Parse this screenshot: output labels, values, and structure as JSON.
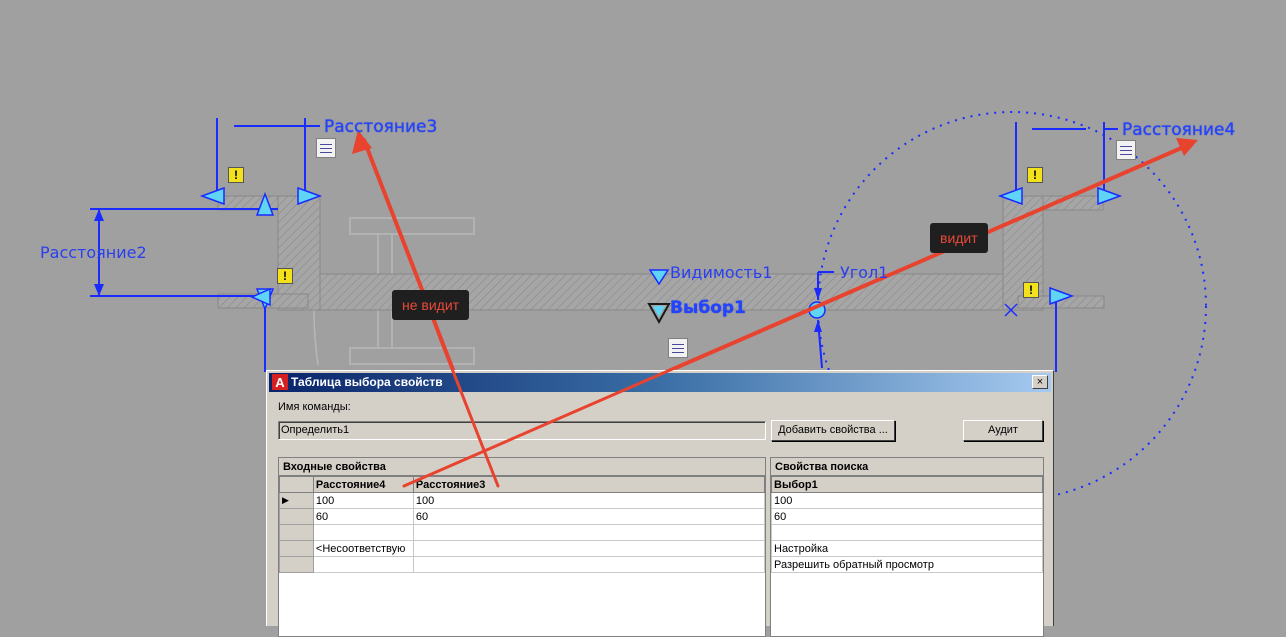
{
  "drawing": {
    "dimension_labels": {
      "distance3": "Расстояние3",
      "distance4": "Расстояние4",
      "distance2": "Расстояние2"
    },
    "parameter_labels": {
      "visibility": "Видимость1",
      "lookup": "Выбор1",
      "angle": "Угол1"
    },
    "callouts": {
      "not_sees": "не видит",
      "sees": "видит"
    },
    "warning_badge": "!",
    "colors": {
      "background": "#a0a0a0",
      "dimension_blue": "#1a2bff",
      "arrow_red": "#e8432f",
      "grip_cyan": "#5fd4f5",
      "warning_yellow": "#f3e21b"
    }
  },
  "dialog": {
    "title": "Таблица выбора свойств",
    "close_glyph": "×",
    "command_name_label": "Имя команды:",
    "command_name_value": "Определить1",
    "add_properties_button": "Добавить свойства ...",
    "audit_button": "Аудит",
    "input_properties": {
      "header": "Входные свойства",
      "columns": [
        "Расстояние4",
        "Расстояние3"
      ],
      "rows": [
        {
          "marker": "▶",
          "cells": [
            "100",
            "100"
          ]
        },
        {
          "marker": "",
          "cells": [
            "60",
            "60"
          ]
        },
        {
          "marker": "",
          "cells": [
            "",
            ""
          ]
        },
        {
          "marker": "",
          "cells": [
            "<Несоответствую",
            ""
          ]
        },
        {
          "marker": "",
          "cells": [
            "",
            ""
          ]
        }
      ]
    },
    "lookup_properties": {
      "header": "Свойства поиска",
      "columns": [
        "Выбор1"
      ],
      "rows": [
        {
          "cells": [
            "100"
          ]
        },
        {
          "cells": [
            "60"
          ]
        },
        {
          "cells": [
            ""
          ]
        },
        {
          "cells": [
            "Настройка"
          ]
        },
        {
          "cells": [
            "Разрешить обратный просмотр"
          ]
        }
      ]
    }
  }
}
